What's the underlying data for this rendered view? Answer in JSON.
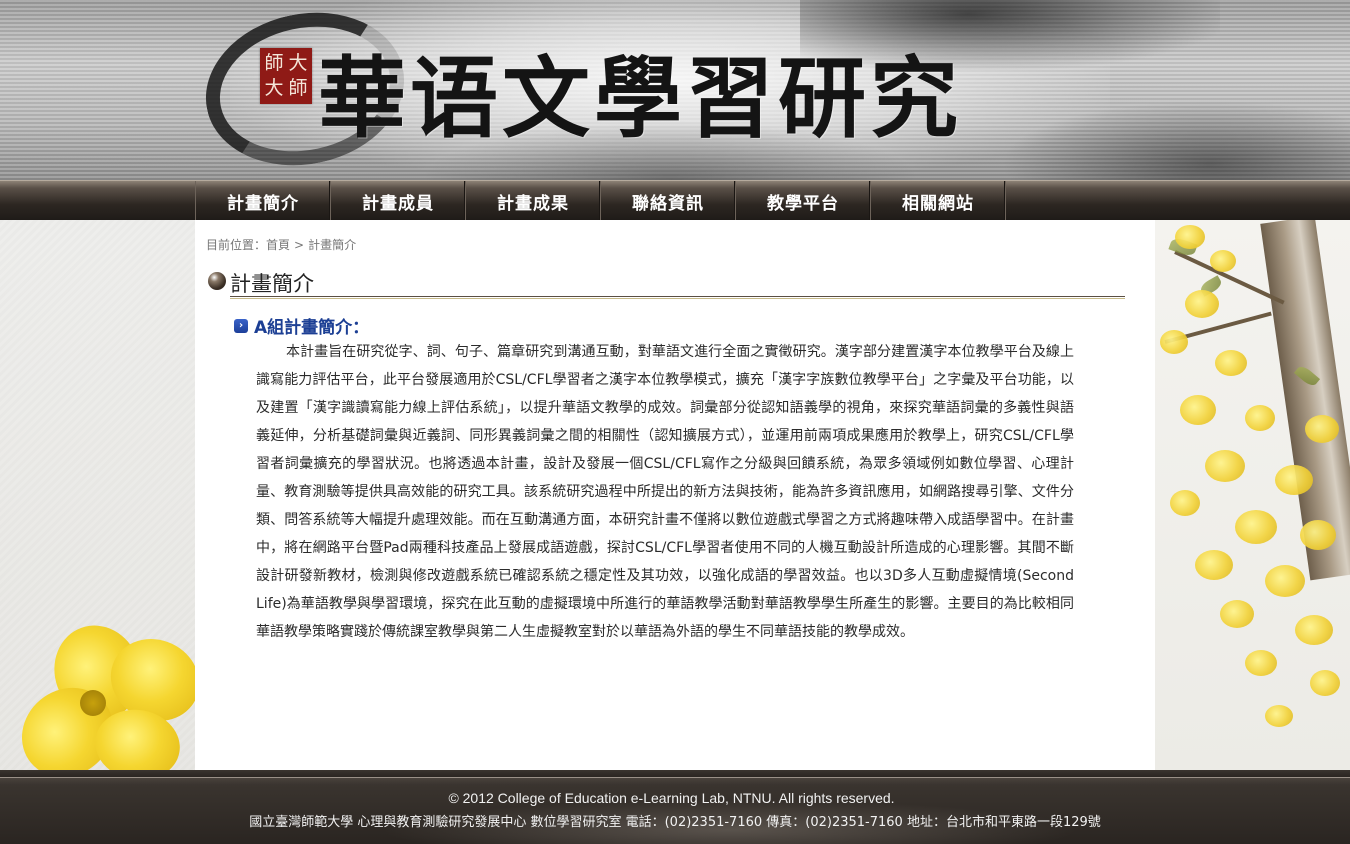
{
  "header": {
    "seal_chars": [
      "師",
      "大",
      "大",
      "師"
    ],
    "site_title": "華语文學習研究"
  },
  "nav": [
    {
      "label": "計畫簡介"
    },
    {
      "label": "計畫成員"
    },
    {
      "label": "計畫成果"
    },
    {
      "label": "聯絡資訊"
    },
    {
      "label": "教學平台"
    },
    {
      "label": "相關網站"
    }
  ],
  "breadcrumb": {
    "prefix": "目前位置：",
    "home": "首頁",
    "separator": ">",
    "current": "計畫簡介"
  },
  "section": {
    "title": "計畫簡介",
    "subsection_title": "A組計畫簡介：",
    "body": "本計畫旨在研究從字、詞、句子、篇章研究到溝通互動，對華語文進行全面之實徵研究。漢字部分建置漢字本位教學平台及線上識寫能力評估平台，此平台發展適用於CSL/CFL學習者之漢字本位教學模式，擴充「漢字字族數位教學平台」之字彙及平台功能，以及建置「漢字識讀寫能力線上評估系統」，以提升華語文教學的成效。詞彙部分從認知語義學的視角，來探究華語詞彙的多義性與語義延伸，分析基礎詞彙與近義詞、同形異義詞彙之間的相關性（認知擴展方式），並運用前兩項成果應用於教學上，研究CSL/CFL學習者詞彙擴充的學習狀況。也將透過本計畫，設計及發展一個CSL/CFL寫作之分級與回饋系統，為眾多領域例如數位學習、心理計量、教育測驗等提供具高效能的研究工具。該系統研究過程中所提出的新方法與技術，能為許多資訊應用，如網路搜尋引擎、文件分類、問答系統等大幅提升處理效能。而在互動溝通方面，本研究計畫不僅將以數位遊戲式學習之方式將趣味帶入成語學習中。在計畫中，將在網路平台暨Pad兩種科技產品上發展成語遊戲，探討CSL/CFL學習者使用不同的人機互動設計所造成的心理影響。其間不斷設計研發新教材，檢測與修改遊戲系統已確認系統之穩定性及其功效，以強化成語的學習效益。也以3D多人互動虛擬情境(Second Life)為華語教學與學習環境，探究在此互動的虛擬環境中所進行的華語教學活動對華語教學學生所產生的影響。主要目的為比較相同華語教學策略實踐於傳統課室教學與第二人生虛擬教室對於以華語為外語的學生不同華語技能的教學成效。"
  },
  "footer": {
    "copyright": "© 2012 College of Education e-Learning Lab, NTNU. All rights reserved.",
    "contact": "國立臺灣師範大學 心理與教育測驗研究發展中心 數位學習研究室 電話：(02)2351-7160 傳真：(02)2351-7160 地址：台北市和平東路一段129號"
  },
  "colors": {
    "nav_bg": "#2d2722",
    "sub_title": "#1c3f94",
    "seal": "#8f1a16",
    "blossom": "#f2d23a"
  }
}
